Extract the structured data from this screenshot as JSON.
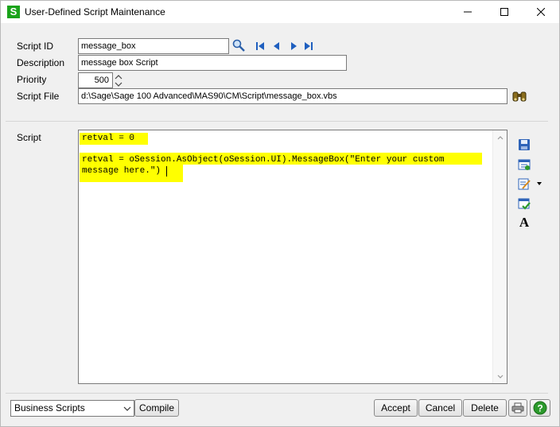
{
  "window": {
    "title": "User-Defined Script Maintenance",
    "app_icon_letter": "S"
  },
  "form": {
    "script_id_label": "Script ID",
    "script_id_value": "message_box",
    "description_label": "Description",
    "description_value": "message box Script",
    "priority_label": "Priority",
    "priority_value": "500",
    "script_file_label": "Script File",
    "script_file_value": "d:\\Sage\\Sage 100 Advanced\\MAS90\\CM\\Script\\message_box.vbs"
  },
  "script": {
    "label": "Script",
    "lines": [
      "retval = 0",
      "",
      "retval = oSession.AsObject(oSession.UI).MessageBox(\"Enter your custom",
      "message here.\")"
    ],
    "highlight_color": "#ffff00"
  },
  "footer": {
    "category_value": "Business Scripts",
    "compile_label": "Compile",
    "accept_label": "Accept",
    "cancel_label": "Cancel",
    "delete_label": "Delete"
  },
  "side_toolbar": {
    "font_glyph": "A"
  },
  "colors": {
    "app_icon": "#1aa31a",
    "nav_arrow": "#1f5fbf"
  }
}
